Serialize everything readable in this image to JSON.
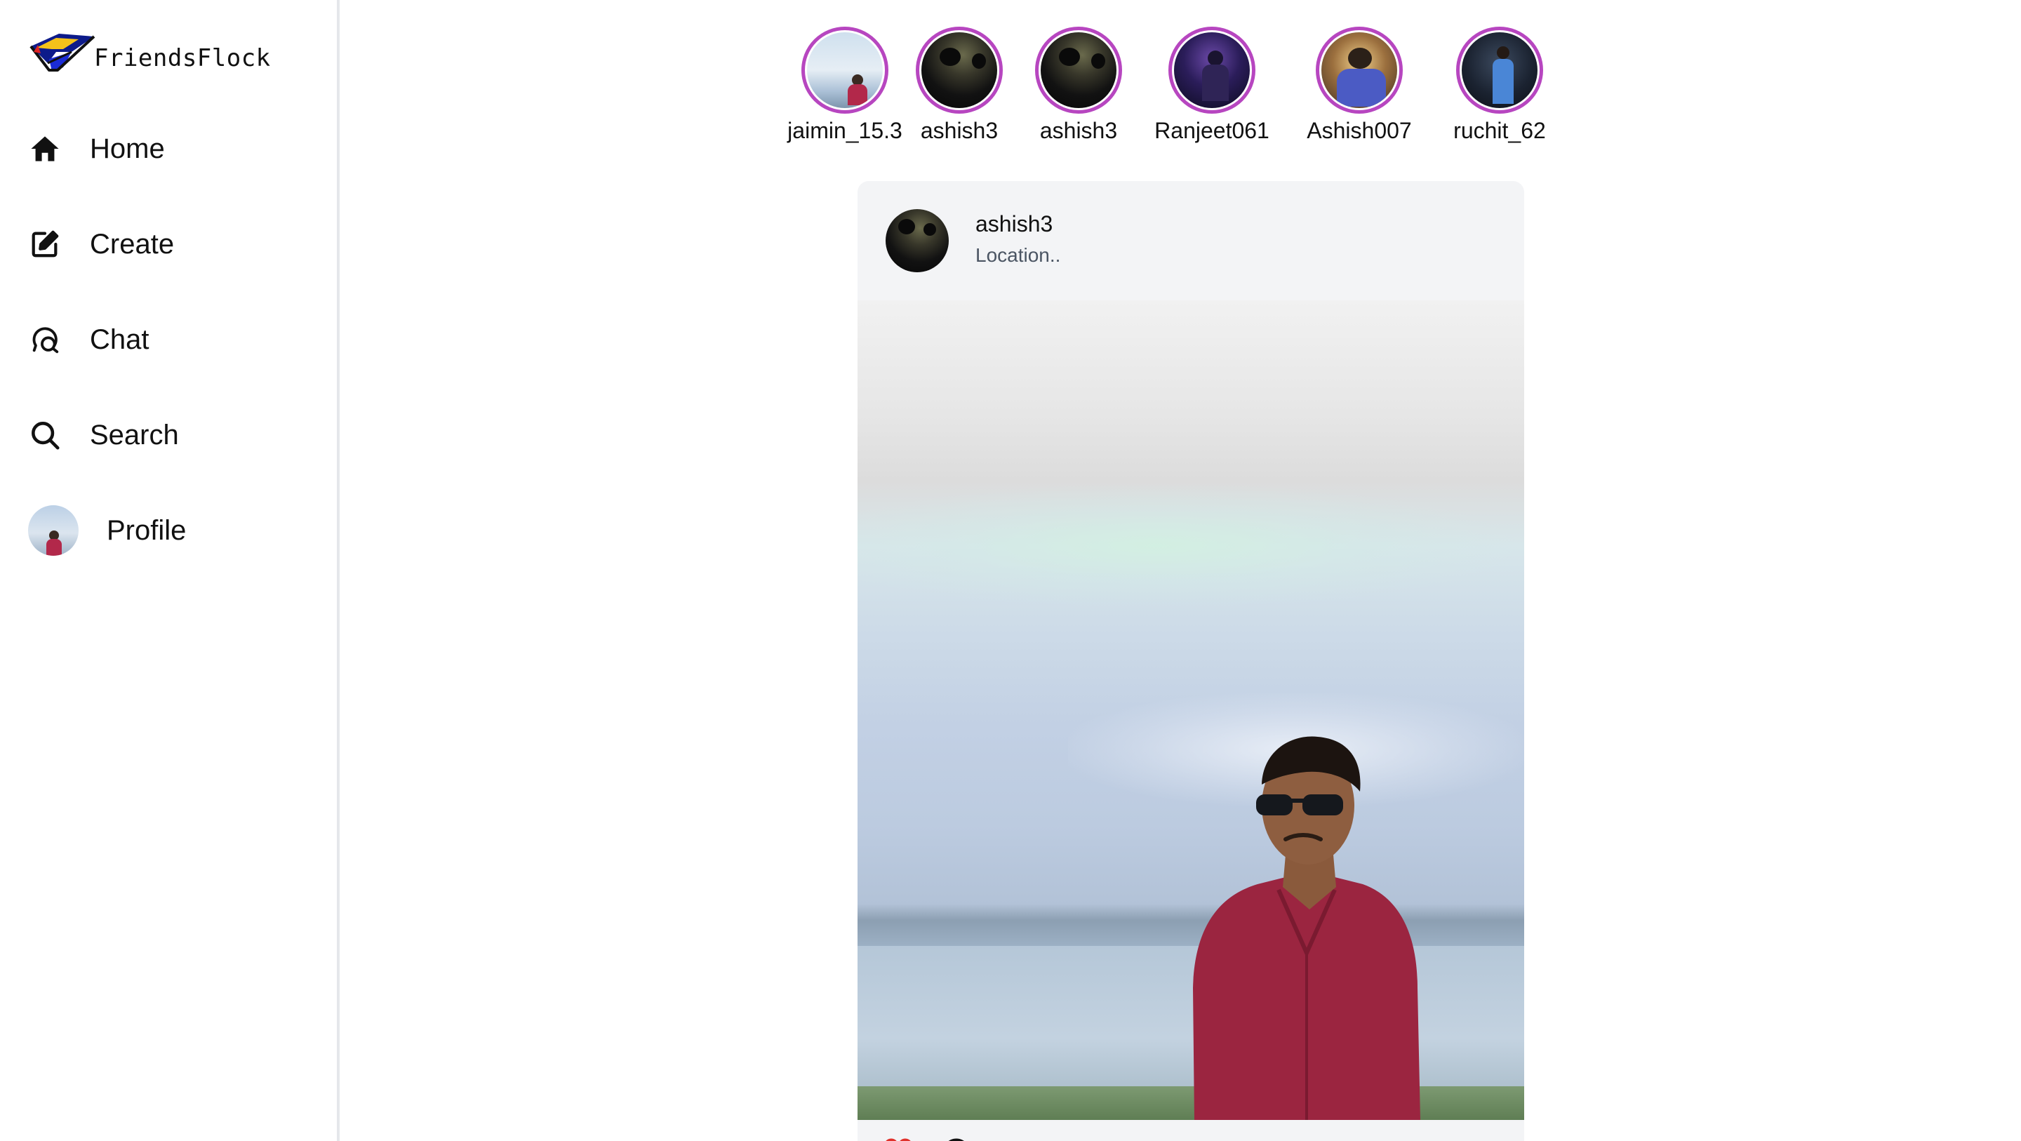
{
  "app": {
    "brand_name": "FriendsFlock",
    "accent_color": "#b746c0",
    "like_color": "#e0312b"
  },
  "sidebar": {
    "items": [
      {
        "label": "Home",
        "icon": "home-icon"
      },
      {
        "label": "Create",
        "icon": "create-icon"
      },
      {
        "label": "Chat",
        "icon": "chat-icon"
      },
      {
        "label": "Search",
        "icon": "search-icon"
      },
      {
        "label": "Profile",
        "icon": "avatar"
      }
    ]
  },
  "stories": [
    {
      "username": "jaimin_15.3"
    },
    {
      "username": "ashish3"
    },
    {
      "username": "ashish3"
    },
    {
      "username": "Ranjeet061"
    },
    {
      "username": "Ashish007"
    },
    {
      "username": "ruchit_62"
    }
  ],
  "post": {
    "username": "ashish3",
    "location": "Location..",
    "actions": [
      "heart-icon",
      "comment-icon"
    ]
  }
}
